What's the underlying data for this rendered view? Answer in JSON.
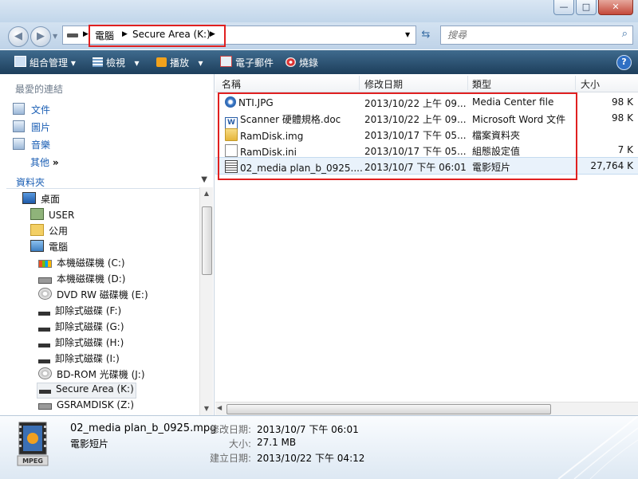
{
  "window": {
    "minimize": "—",
    "maximize": "□",
    "close": "✕"
  },
  "nav": {
    "back": "◀",
    "forward": "▶",
    "dropdown": "▼"
  },
  "address": {
    "crumbs": [
      "電腦",
      "Secure Area (K:)"
    ]
  },
  "search": {
    "placeholder": "搜尋"
  },
  "toolbar": {
    "items": [
      "組合管理",
      "檢視",
      "播放",
      "電子郵件",
      "燒錄"
    ],
    "help": "?"
  },
  "navpane": {
    "favorites_header": "最愛的連結",
    "favorites": [
      "文件",
      "圖片",
      "音樂"
    ],
    "more": "其他",
    "more_chevron": "»",
    "folders_header": "資料夾",
    "tree": [
      "桌面",
      "USER",
      "公用",
      "電腦",
      "本機磁碟機 (C:)",
      "本機磁碟機 (D:)",
      "DVD RW 磁碟機 (E:)",
      "卸除式磁碟 (F:)",
      "卸除式磁碟 (G:)",
      "卸除式磁碟 (H:)",
      "卸除式磁碟 (I:)",
      "BD-ROM 光碟機 (J:)",
      "Secure Area (K:)",
      "GSRAMDISK (Z:)"
    ]
  },
  "columns": {
    "name": "名稱",
    "date": "修改日期",
    "type": "類型",
    "size": "大小"
  },
  "files": [
    {
      "name": "NTI.JPG",
      "date": "2013/10/22 上午 09...",
      "type": "Media Center file",
      "size": "98 K"
    },
    {
      "name": "Scanner 硬體規格.doc",
      "date": "2013/10/22 上午 09...",
      "type": "Microsoft Word 文件",
      "size": "98 K"
    },
    {
      "name": "RamDisk.img",
      "date": "2013/10/17 下午 05...",
      "type": "檔案資料夾",
      "size": ""
    },
    {
      "name": "RamDisk.ini",
      "date": "2013/10/17 下午 05...",
      "type": "組態設定值",
      "size": "7 K"
    },
    {
      "name": "02_media plan_b_0925....",
      "date": "2013/10/7 下午 06:01",
      "type": "電影短片",
      "size": "27,764 K"
    }
  ],
  "details": {
    "name": "02_media plan_b_0925.mpg",
    "type": "電影短片",
    "icon_label": "MPEG",
    "modified_label": "修改日期:",
    "modified": "2013/10/7 下午 06:01",
    "size_label": "大小:",
    "size": "27.1 MB",
    "created_label": "建立日期:",
    "created": "2013/10/22 下午 04:12"
  },
  "colors": {
    "accent": "#1a5eb4",
    "toolbar": "#2a5170",
    "highlight": "#e02020"
  }
}
